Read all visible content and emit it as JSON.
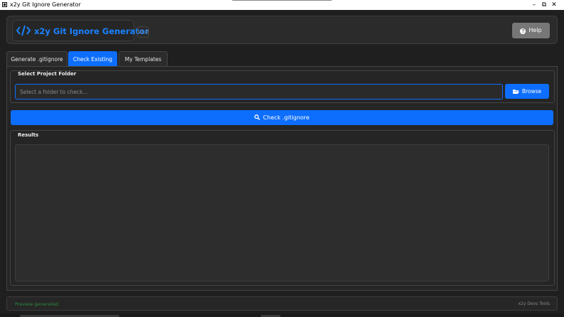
{
  "window": {
    "title": "x2y Git Ignore Generator",
    "minimize_glyph": "–",
    "restore_glyph": "⧉",
    "close_glyph": "✕"
  },
  "header": {
    "brand_icon": "code-icon",
    "app_name": "x2y Git Ignore Generator",
    "version": "v1.0",
    "help_label": "Help",
    "help_icon": "question-circle-icon"
  },
  "tabs": [
    {
      "label": "Generate .gitignore",
      "active": false
    },
    {
      "label": "Check Existing",
      "active": true
    },
    {
      "label": "My Templates",
      "active": false
    }
  ],
  "folder_section": {
    "title": "Select Project Folder",
    "input_value": "",
    "input_placeholder": "Select a folder to check...",
    "browse_label": "Browse",
    "browse_icon": "folder-open-icon"
  },
  "check_button": {
    "label": "Check .gitignore",
    "icon": "search-icon"
  },
  "results_section": {
    "title": "Results",
    "content": ""
  },
  "status_bar": {
    "status_text": "Preview generated",
    "brand_text": "x2y Devs Tools"
  },
  "colors": {
    "accent": "#0d6efd",
    "brand_text": "#1a82ff",
    "status_ok": "#2e8b3d",
    "background": "#1f1f1f"
  }
}
